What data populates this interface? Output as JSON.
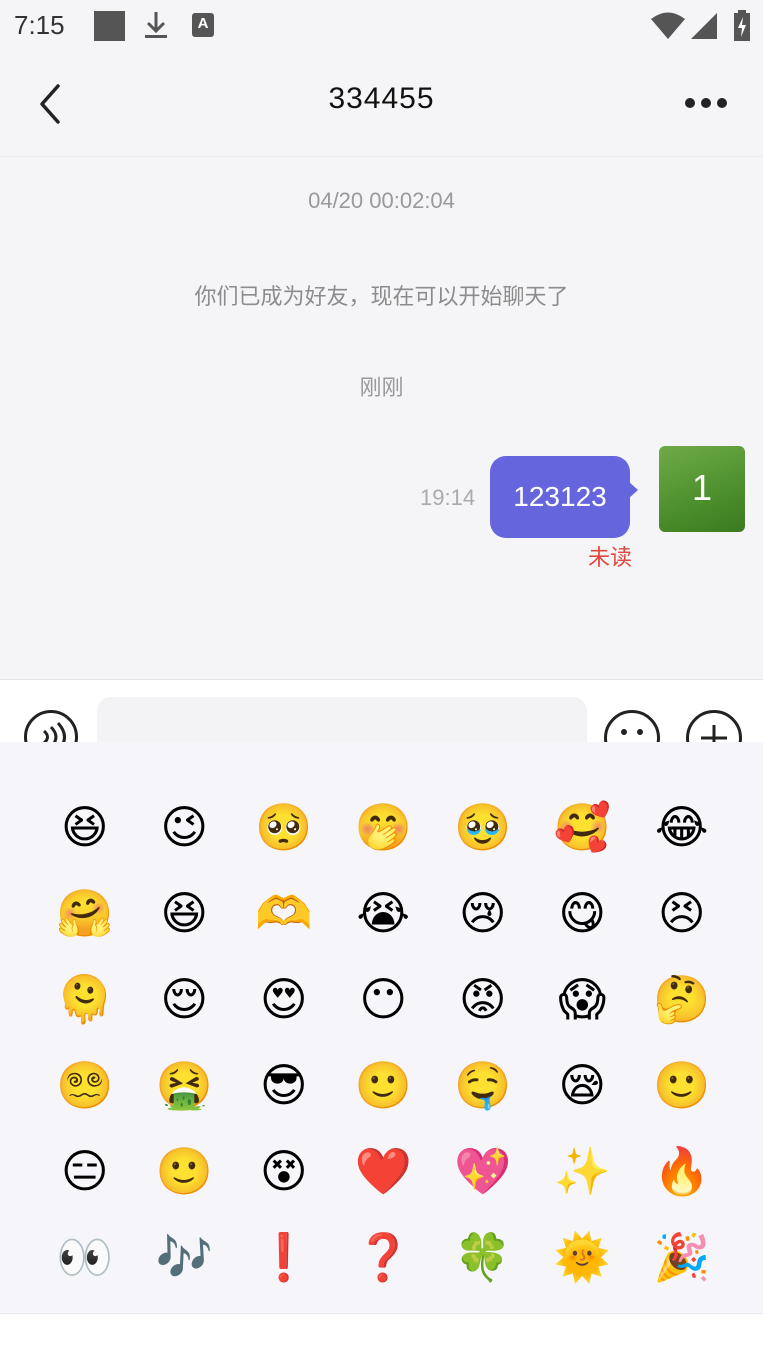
{
  "status_bar": {
    "time": "7:15",
    "icons": [
      "square-notification-icon",
      "download-icon",
      "a-keyboard-icon",
      "wifi-icon",
      "signal-icon",
      "battery-charging-icon"
    ],
    "a_icon_label": "A"
  },
  "header": {
    "title": "334455",
    "back_icon": "chevron-left-icon",
    "more_icon": "more-dots-icon"
  },
  "chat": {
    "timestamp_1": "04/20 00:02:04",
    "system_message": "你们已成为好友，现在可以开始聊天了",
    "timestamp_2": "刚刚",
    "messages": [
      {
        "time": "19:14",
        "text": "123123",
        "status": "未读",
        "avatar_text": "1"
      }
    ]
  },
  "input_bar": {
    "value": "",
    "placeholder": "",
    "voice_icon": "voice-icon",
    "emoji_icon": "emoji-face-icon",
    "plus_icon": "plus-icon"
  },
  "emoji_panel": {
    "emojis": [
      "😆",
      "😉",
      "🥺",
      "🤭",
      "🥹",
      "🥰",
      "😂",
      "🤗",
      "😆",
      "🫶",
      "😭",
      "😢",
      "😋",
      "😣",
      "🫠",
      "😌",
      "😍",
      "😶",
      "😡",
      "😱",
      "🤔",
      "😵‍💫",
      "🤮",
      "😎",
      "🙂",
      "🤤",
      "😪",
      "🙂",
      "😑",
      "🙂",
      "😵",
      "❤️",
      "💖",
      "✨",
      "🔥",
      "👀",
      "🎶",
      "❗",
      "❓",
      "🍀",
      "🌞",
      "🎉"
    ]
  },
  "colors": {
    "bubble": "#6566dd",
    "unread": "#e0483e",
    "avatar": "#5a9a36"
  }
}
